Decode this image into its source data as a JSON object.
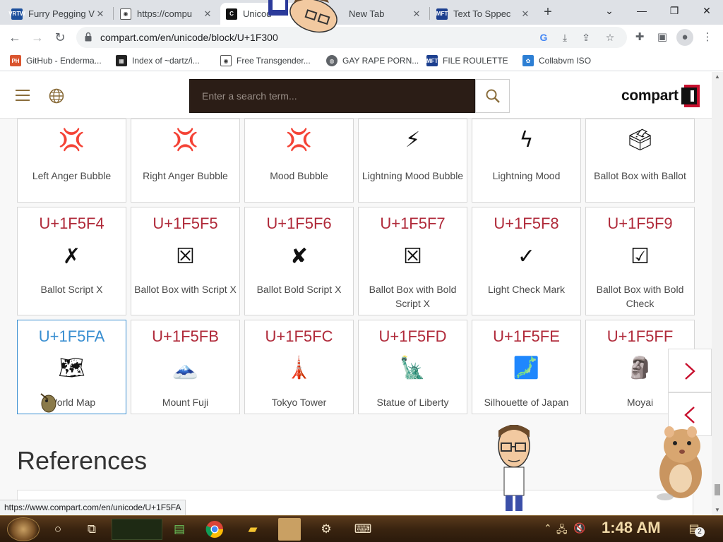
{
  "browser": {
    "tabs": [
      {
        "title": "Furry Pegging V",
        "favicon": "vrtw-icon",
        "active": false
      },
      {
        "title": "https://compu",
        "favicon": "globe-icon",
        "active": false
      },
      {
        "title": "Unicod",
        "favicon": "compart-icon",
        "active": true
      },
      {
        "title": "New Tab",
        "favicon": "",
        "active": false
      },
      {
        "title": "Text To Sppec",
        "favicon": "mft-icon",
        "active": false
      }
    ],
    "url": "compart.com/en/unicode/block/U+1F300",
    "bookmarks": [
      {
        "label": "GitHub - Enderma...",
        "icon": "ph-icon"
      },
      {
        "label": "Index of ~dartz/i...",
        "icon": "dartz-icon"
      },
      {
        "label": "Free Transgender...",
        "icon": "globe-icon"
      },
      {
        "label": "GAY RAPE PORN...",
        "icon": "globe-icon"
      },
      {
        "label": "FILE ROULETTE",
        "icon": "mft-icon"
      },
      {
        "label": "Collabvm ISO",
        "icon": "collabvm-icon"
      }
    ]
  },
  "site": {
    "search_placeholder": "Enter a search term...",
    "logo_text": "compart"
  },
  "grid": {
    "row1": [
      {
        "glyph": "💢",
        "name": "Left Anger Bubble"
      },
      {
        "glyph": "💢",
        "name": "Right Anger Bubble"
      },
      {
        "glyph": "💢",
        "name": "Mood Bubble"
      },
      {
        "glyph": "⚡",
        "name": "Lightning Mood Bubble"
      },
      {
        "glyph": "ϟ",
        "name": "Lightning Mood"
      },
      {
        "glyph": "🗳",
        "name": "Ballot Box with Ballot"
      }
    ],
    "row2": [
      {
        "code": "U+1F5F4",
        "glyph": "✗",
        "name": "Ballot Script X"
      },
      {
        "code": "U+1F5F5",
        "glyph": "☒",
        "name": "Ballot Box with Script X"
      },
      {
        "code": "U+1F5F6",
        "glyph": "✘",
        "name": "Ballot Bold Script X"
      },
      {
        "code": "U+1F5F7",
        "glyph": "☒",
        "name": "Ballot Box with Bold Script X"
      },
      {
        "code": "U+1F5F8",
        "glyph": "✓",
        "name": "Light Check Mark"
      },
      {
        "code": "U+1F5F9",
        "glyph": "☑",
        "name": "Ballot Box with Bold Check"
      }
    ],
    "row3": [
      {
        "code": "U+1F5FA",
        "glyph": "🗺",
        "name": "World Map"
      },
      {
        "code": "U+1F5FB",
        "glyph": "🗻",
        "name": "Mount Fuji"
      },
      {
        "code": "U+1F5FC",
        "glyph": "🗼",
        "name": "Tokyo Tower"
      },
      {
        "code": "U+1F5FD",
        "glyph": "🗽",
        "name": "Statue of Liberty"
      },
      {
        "code": "U+1F5FE",
        "glyph": "🗾",
        "name": "Silhouette of Japan"
      },
      {
        "code": "U+1F5FF",
        "glyph": "🗿",
        "name": "Moyai"
      }
    ]
  },
  "section_heading": "References",
  "status_url": "https://www.compart.com/en/unicode/U+1F5FA",
  "taskbar": {
    "time": "1:48 AM",
    "notification_count": "2"
  },
  "colors": {
    "code_red": "#b02a3a",
    "selected_blue": "#3a8fd1",
    "search_bg": "#2b1d16",
    "accent_red": "#c8102e"
  }
}
